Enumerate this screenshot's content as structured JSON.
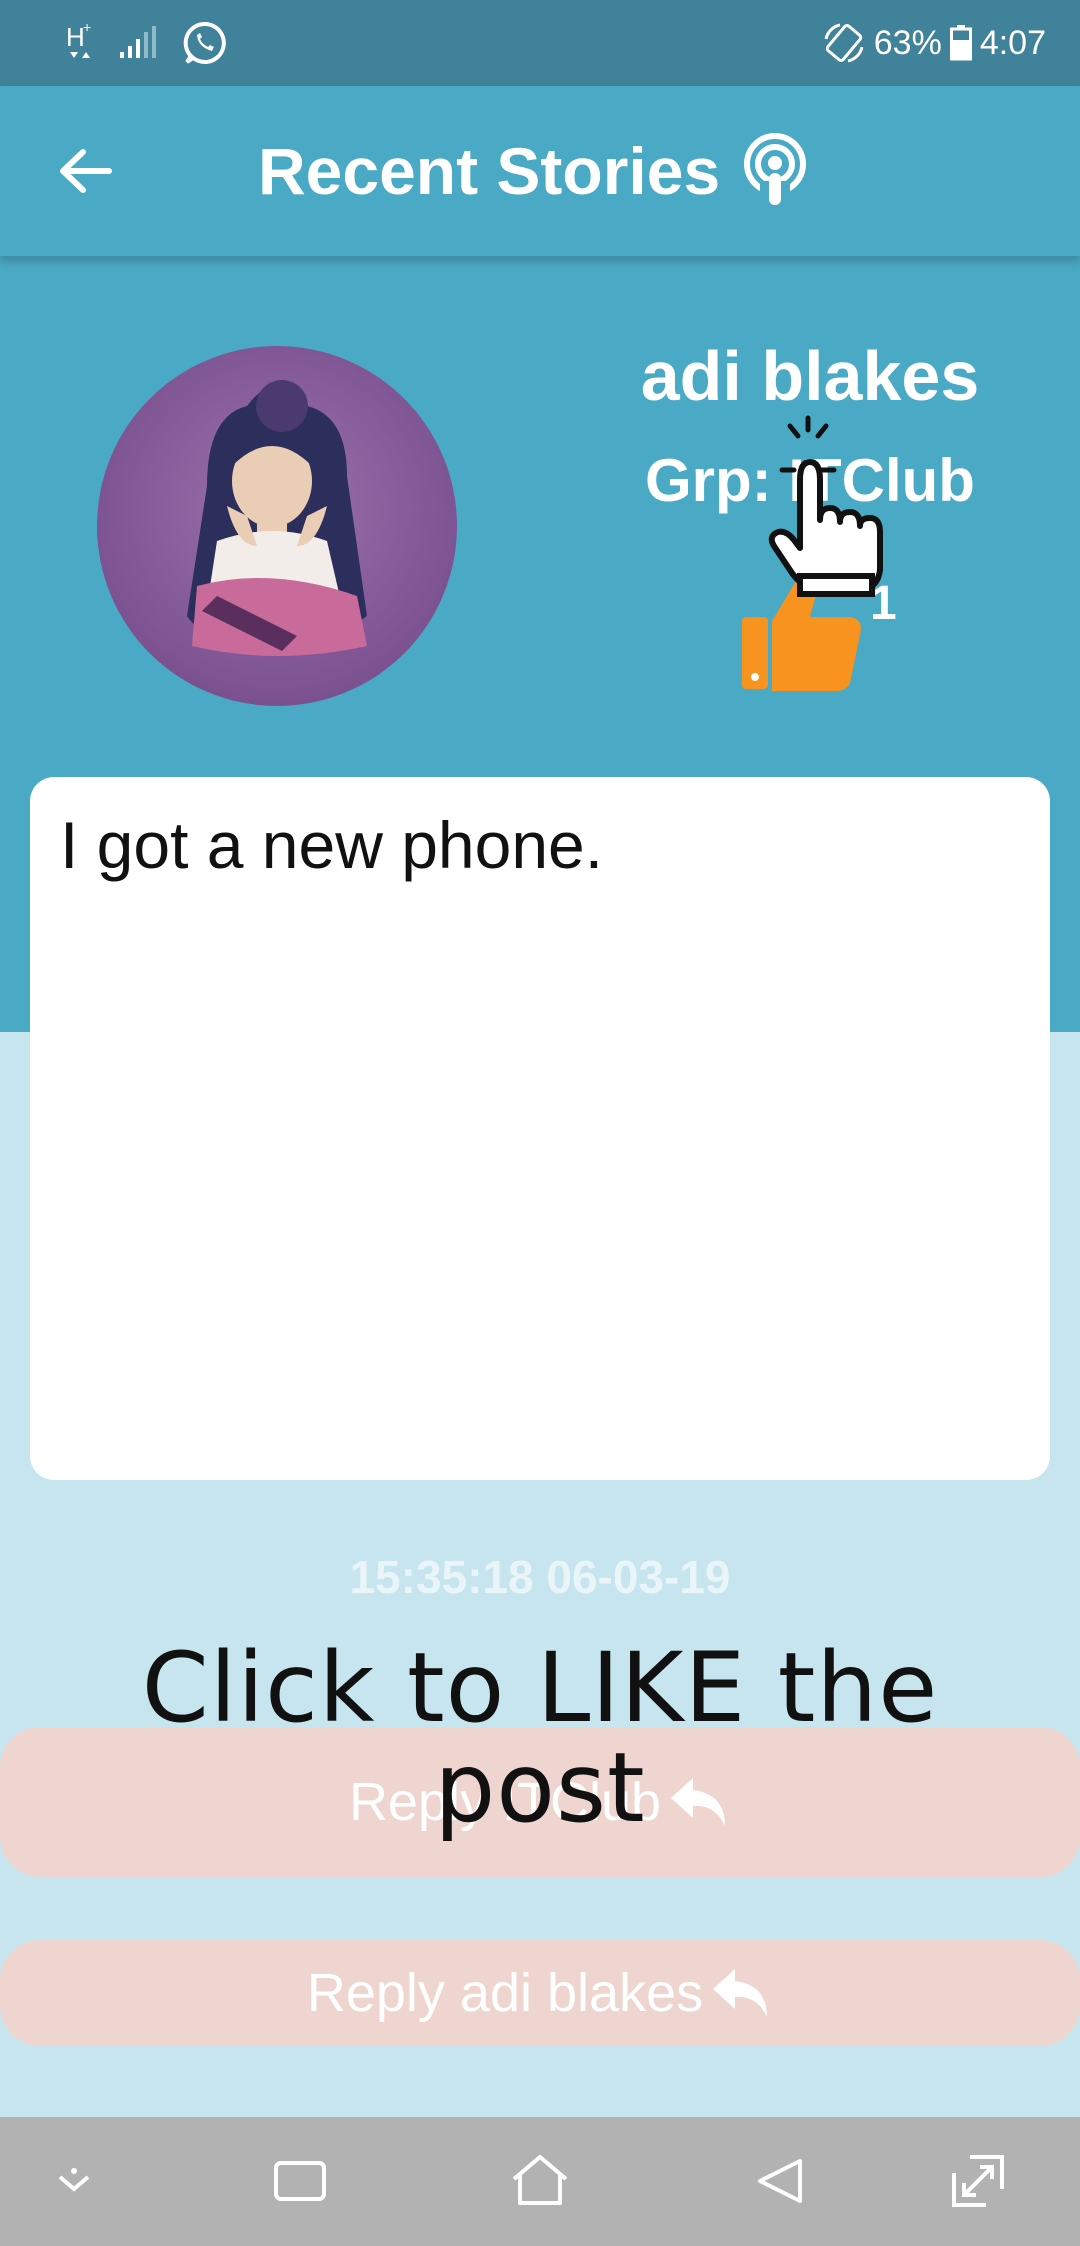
{
  "status_bar": {
    "network_label": "H+",
    "battery_percent": "63%",
    "time": "4:07",
    "icons": [
      "network-type-icon",
      "signal-icon",
      "whatsapp-icon",
      "rotate-icon",
      "battery-icon"
    ]
  },
  "app_bar": {
    "title": "Recent Stories",
    "back_icon": "arrow-left-icon",
    "title_icon": "podcast-icon"
  },
  "story": {
    "author": "adi blakes",
    "group": "Grp: ITClub",
    "likes": "1",
    "text": "I got a new phone.",
    "timestamp": "15:35:18 06-03-19"
  },
  "actions": {
    "reply_group": "Reply ITClub",
    "reply_user": "Reply adi blakes"
  },
  "overlay": {
    "hint": "Click to LIKE the post"
  },
  "colors": {
    "status_bar": "#3f8299",
    "app_bar": "#4aa9c5",
    "page_bg": "#c7e5ee",
    "reply_button": "#efd5cf",
    "like_icon": "#f7931e",
    "nav_bar": "#b2b2b2"
  },
  "nav": [
    "chevron-down-icon",
    "recents-icon",
    "home-icon",
    "back-triangle-icon",
    "expand-icon"
  ]
}
